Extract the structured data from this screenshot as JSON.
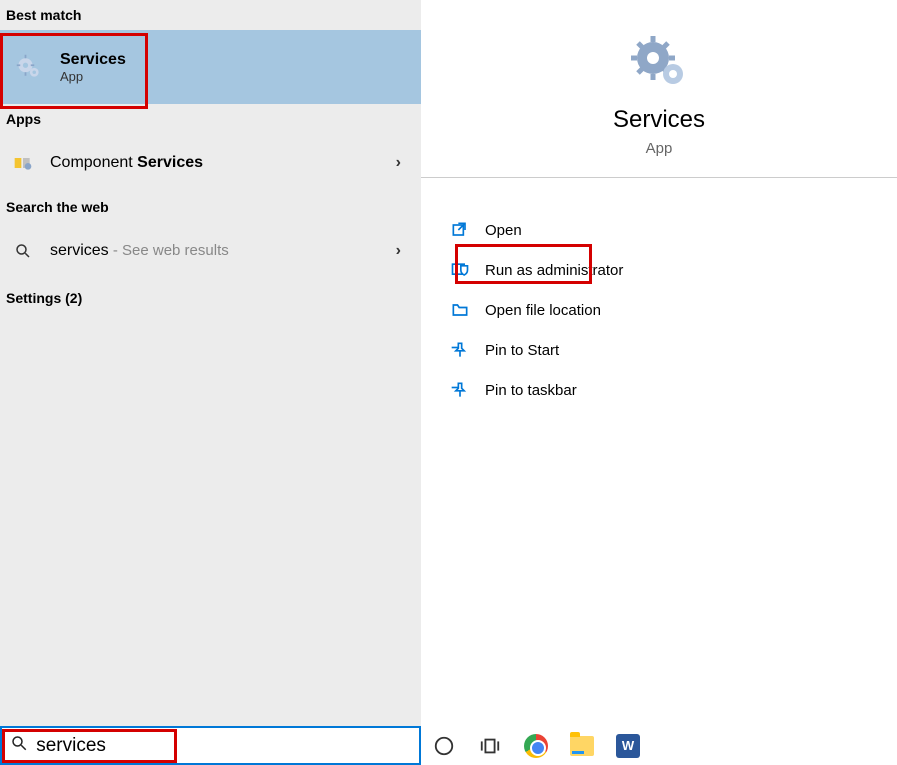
{
  "left": {
    "best_match_header": "Best match",
    "best_match": {
      "title": "Services",
      "subtitle": "App"
    },
    "apps_header": "Apps",
    "apps": [
      {
        "prefix": "Component ",
        "bold": "Services"
      }
    ],
    "web_header": "Search the web",
    "web": [
      {
        "term": "services",
        "suffix": " - See web results"
      }
    ],
    "settings_header": "Settings (2)"
  },
  "right": {
    "title": "Services",
    "subtitle": "App",
    "actions": {
      "open": "Open",
      "admin": "Run as administrator",
      "file_location": "Open file location",
      "pin_start": "Pin to Start",
      "pin_taskbar": "Pin to taskbar"
    }
  },
  "search": {
    "value": "services"
  }
}
